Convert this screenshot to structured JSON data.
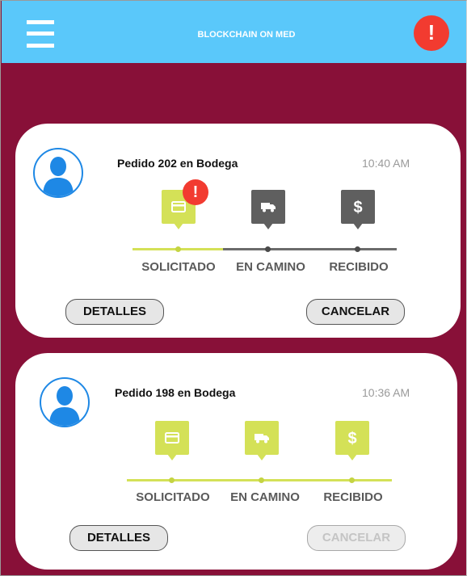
{
  "app": {
    "title": "BLOCKCHAIN ON MED",
    "alert_symbol": "!"
  },
  "colors": {
    "header": "#5ac8fa",
    "background": "#881038",
    "step_active": "#d4e157",
    "step_pending": "#5f5f5f",
    "alert": "#f23b30",
    "avatar": "#1e88e5"
  },
  "orders": [
    {
      "title": "Pedido 202 en Bodega",
      "time": "10:40 AM",
      "alert_symbol": "!",
      "steps": [
        {
          "label": "SOLICITADO",
          "icon": "card-icon",
          "state": "active"
        },
        {
          "label": "EN CAMINO",
          "icon": "truck-icon",
          "state": "pending"
        },
        {
          "label": "RECIBIDO",
          "icon": "dollar-icon",
          "state": "pending"
        }
      ],
      "details_label": "DETALLES",
      "cancel_label": "CANCELAR",
      "cancel_enabled": true
    },
    {
      "title": "Pedido 198 en Bodega",
      "time": "10:36 AM",
      "steps": [
        {
          "label": "SOLICITADO",
          "icon": "card-icon",
          "state": "active"
        },
        {
          "label": "EN CAMINO",
          "icon": "truck-icon",
          "state": "active"
        },
        {
          "label": "RECIBIDO",
          "icon": "dollar-icon",
          "state": "active"
        }
      ],
      "details_label": "DETALLES",
      "cancel_label": "CANCELAR",
      "cancel_enabled": false
    }
  ]
}
